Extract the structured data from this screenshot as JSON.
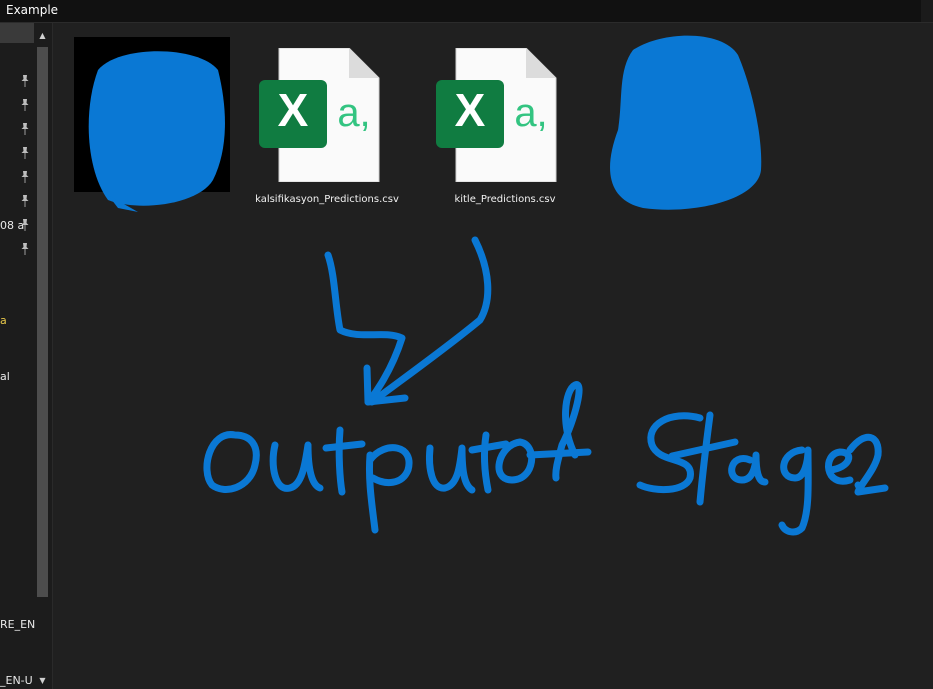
{
  "window": {
    "title": "Example"
  },
  "navigation": {
    "pinned_count": 8,
    "fragments": [
      {
        "text": "08 a",
        "color": "#e8e8e8"
      },
      {
        "text": "a",
        "color": "#e8c84a"
      },
      {
        "text": "al",
        "color": "#e8e8e8"
      },
      {
        "text": "RE_EN-",
        "color": "#e8e8e8"
      },
      {
        "text": "_EN-U",
        "color": "#e8e8e8"
      }
    ]
  },
  "files": [
    {
      "name": "",
      "type": "image-redacted"
    },
    {
      "name": "kalsifikasyon_Predictions.csv",
      "type": "csv",
      "icon": "excel-csv-icon"
    },
    {
      "name": "kitle_Predictions.csv",
      "type": "csv",
      "icon": "excel-csv-icon"
    },
    {
      "name": "",
      "type": "file-redacted"
    }
  ],
  "annotation": {
    "text": "Output of Stage.2",
    "color": "#0a78d4"
  },
  "colors": {
    "background": "#202020",
    "excel_green": "#107c41",
    "csv_accent": "#33c481",
    "scribble_blue": "#0a78d4"
  }
}
